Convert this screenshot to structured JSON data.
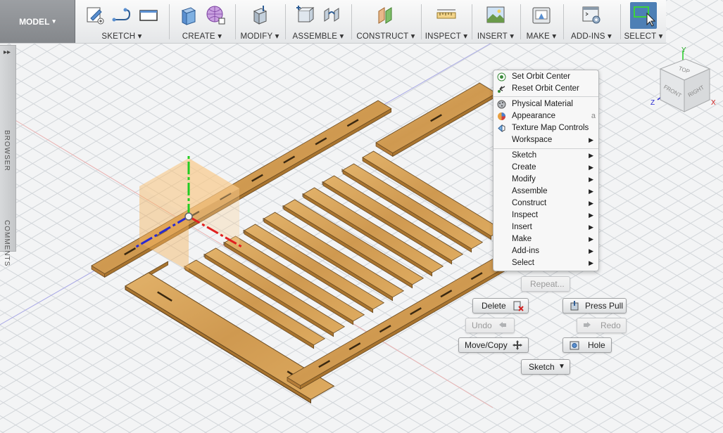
{
  "toolbar": {
    "model_label": "MODEL",
    "groups": [
      {
        "label": "SKETCH"
      },
      {
        "label": "CREATE"
      },
      {
        "label": "MODIFY"
      },
      {
        "label": "ASSEMBLE"
      },
      {
        "label": "CONSTRUCT"
      },
      {
        "label": "INSPECT"
      },
      {
        "label": "INSERT"
      },
      {
        "label": "MAKE"
      },
      {
        "label": "ADD-INS"
      },
      {
        "label": "SELECT"
      }
    ],
    "dropdown_glyph": "▾"
  },
  "sidebar": {
    "expand_glyph": "▸▸",
    "browser_label": "BROWSER",
    "comments_label": "COMMENTS"
  },
  "viewcube": {
    "top": "TOP",
    "front": "FRONT",
    "right": "RIGHT",
    "axis_x": "X",
    "axis_y": "Y",
    "axis_z": "Z"
  },
  "context_menu": {
    "items": [
      {
        "label": "Set Orbit Center",
        "icon": "orbit-center-icon"
      },
      {
        "label": "Reset Orbit Center",
        "icon": "reset-orbit-icon"
      },
      {
        "label": "Physical Material",
        "icon": "physical-material-icon"
      },
      {
        "label": "Appearance",
        "icon": "appearance-icon",
        "shortcut": "a"
      },
      {
        "label": "Texture Map Controls",
        "icon": "texture-map-icon"
      },
      {
        "label": "Workspace",
        "submenu": true
      },
      {
        "label": "Sketch",
        "submenu": true
      },
      {
        "label": "Create",
        "submenu": true
      },
      {
        "label": "Modify",
        "submenu": true
      },
      {
        "label": "Assemble",
        "submenu": true
      },
      {
        "label": "Construct",
        "submenu": true
      },
      {
        "label": "Inspect",
        "submenu": true
      },
      {
        "label": "Insert",
        "submenu": true
      },
      {
        "label": "Make",
        "submenu": true
      },
      {
        "label": "Add-ins",
        "submenu": true
      },
      {
        "label": "Select",
        "submenu": true
      }
    ],
    "submenu_glyph": "▶"
  },
  "marking_menu": {
    "repeat": "Repeat...",
    "delete": "Delete",
    "press_pull": "Press Pull",
    "undo": "Undo",
    "redo": "Redo",
    "move_copy": "Move/Copy",
    "hole": "Hole",
    "sketch": "Sketch",
    "sketch_glyph": "▼"
  },
  "colors": {
    "wood": "#d9a55a",
    "wood_dark": "#a8742f",
    "select_blue": "#4d7fb5",
    "axis_red": "#e04040",
    "axis_green": "#22cc22",
    "axis_blue": "#2a2ad0"
  }
}
